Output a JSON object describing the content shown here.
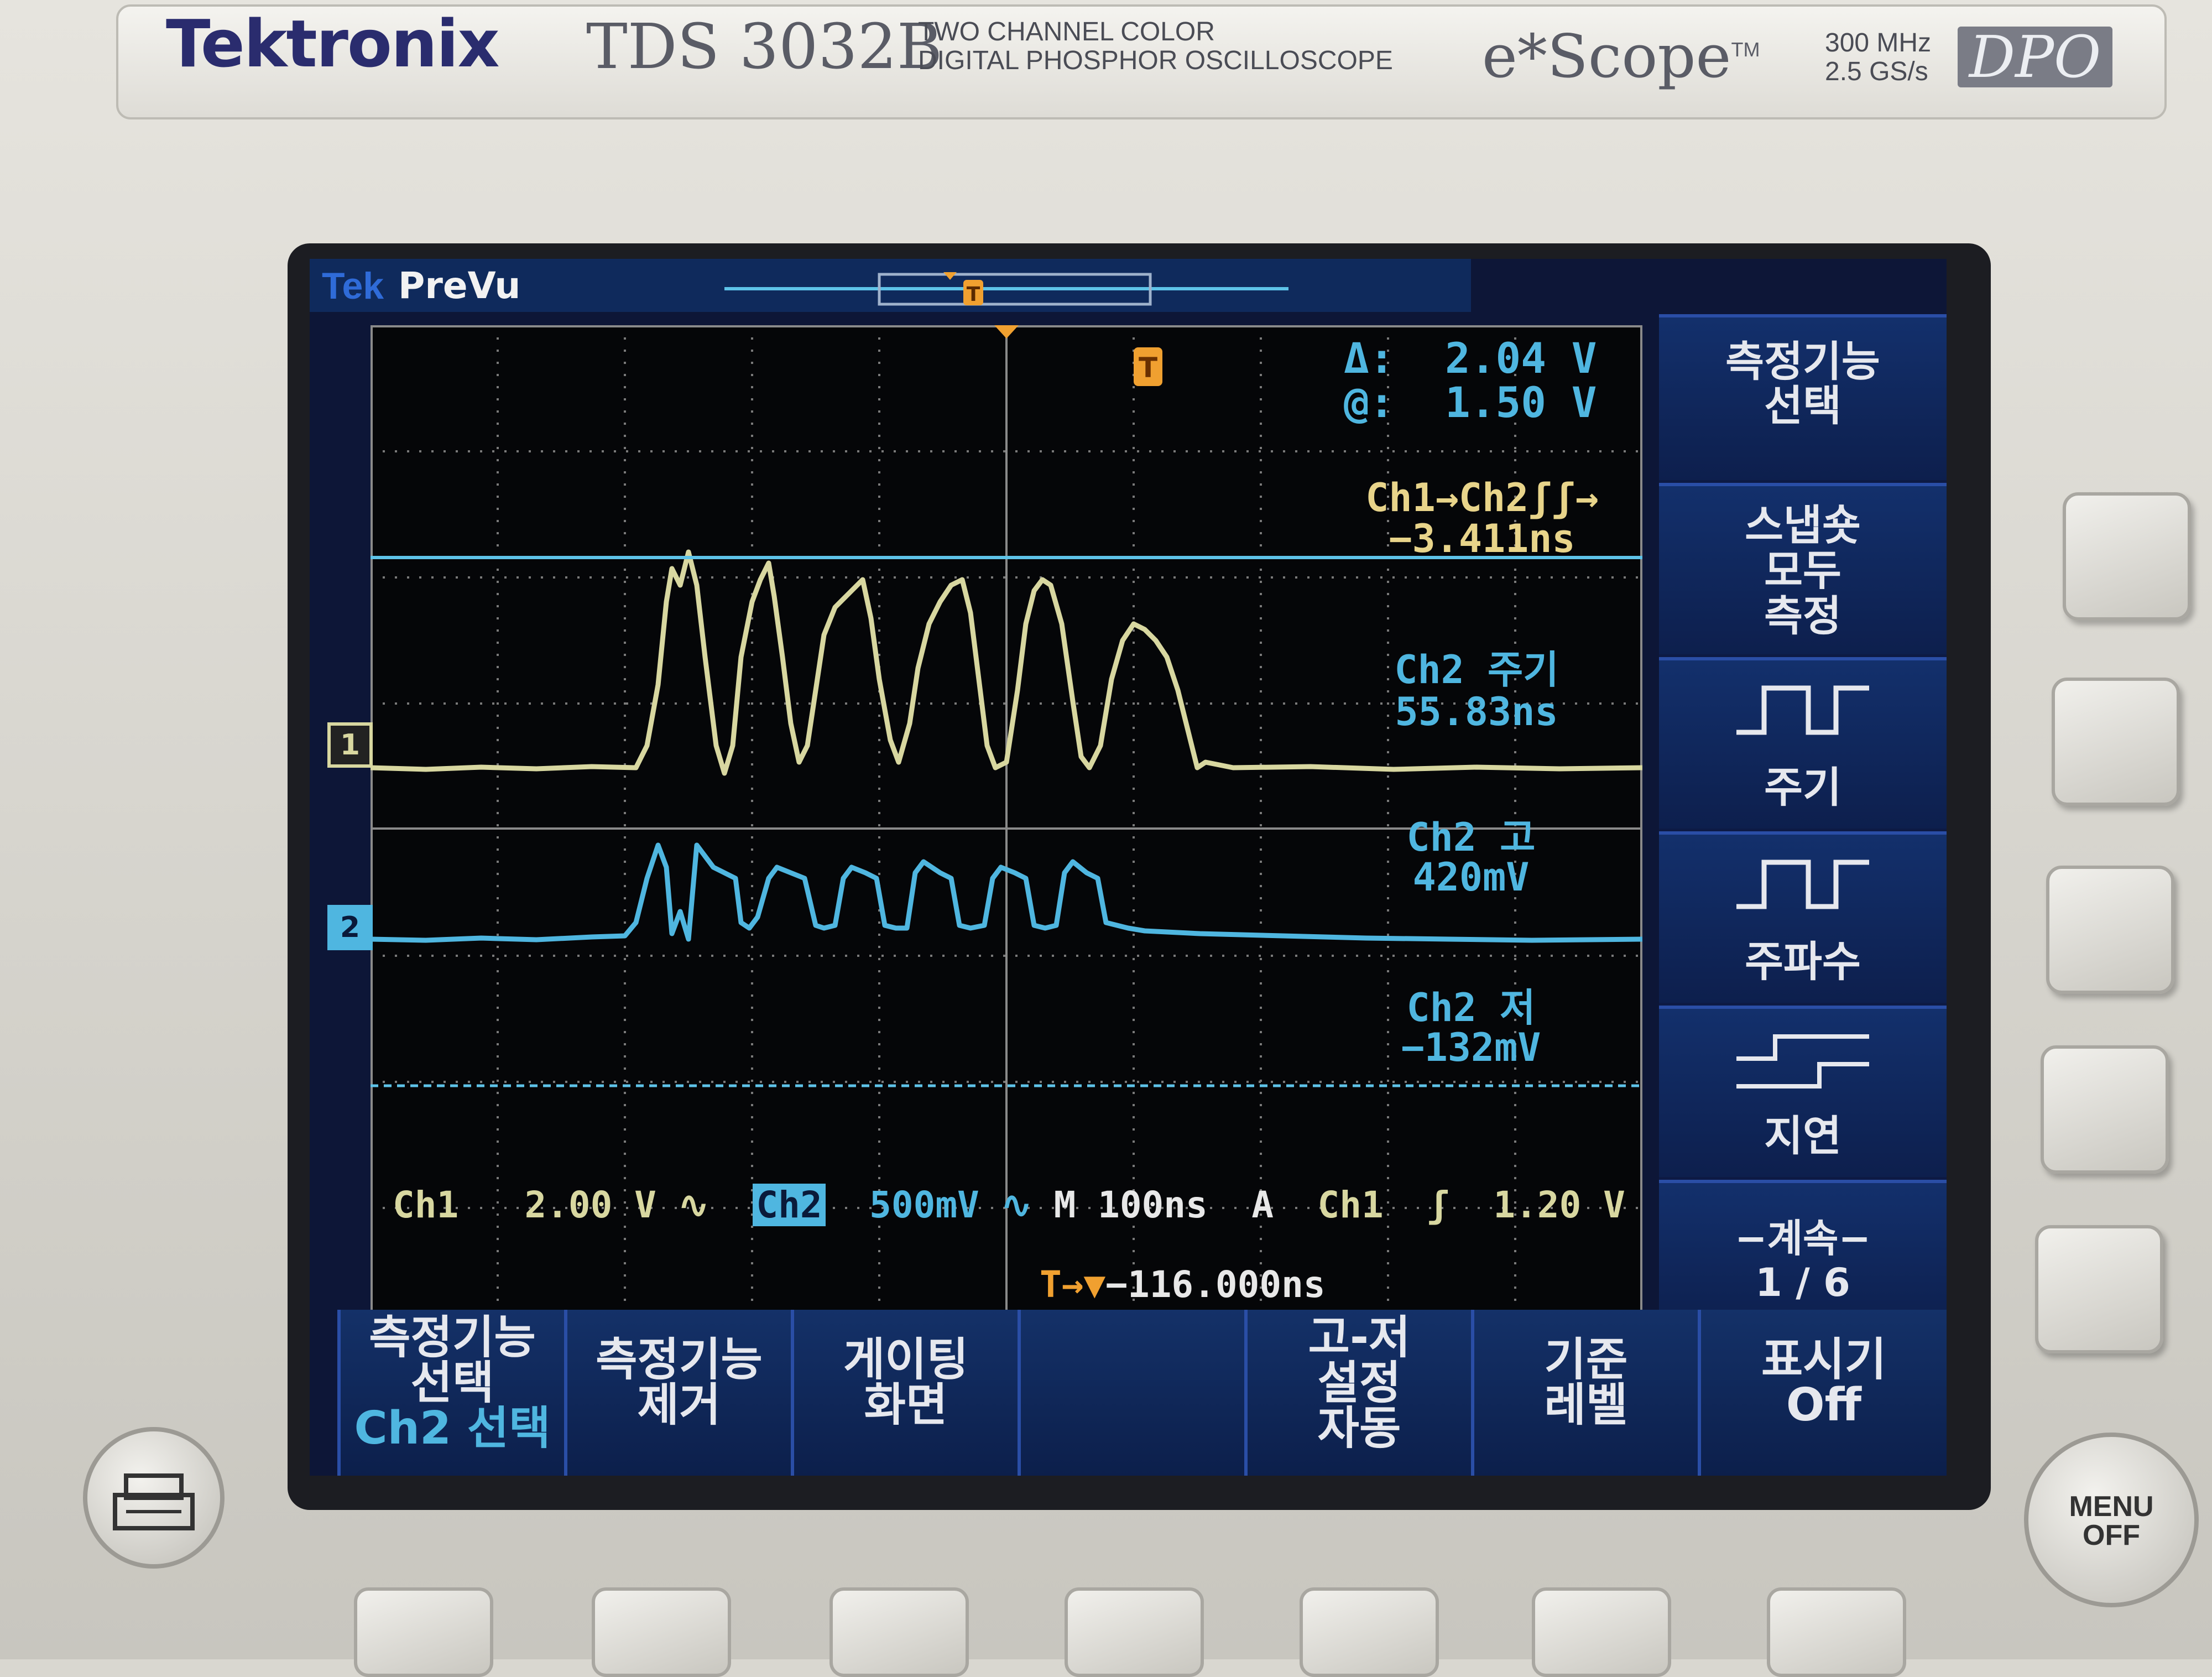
{
  "device": {
    "brand": "Tektronix",
    "model": "TDS 3032B",
    "description_line1": "TWO CHANNEL COLOR",
    "description_line2": "DIGITAL PHOSPHOR OSCILLOSCOPE",
    "series": "e*Scope",
    "series_tm": "TM",
    "bandwidth": "300 MHz",
    "sample_rate": "2.5 GS/s",
    "badge": "DPO"
  },
  "screen": {
    "logo": "Tek",
    "mode": "PreVu",
    "trigger_marker": "T",
    "readouts": {
      "delta_label": "Δ:",
      "delta_value": "2.04 V",
      "at_label": "@:",
      "at_value": "1.50 V",
      "delay_label": "Ch1→Ch2ʃʃ→",
      "delay_value": "−3.411ns",
      "period_label": "Ch2 주기",
      "period_value": "55.83ns",
      "high_label": "Ch2 고",
      "high_value": "420mV",
      "low_label": "Ch2 저",
      "low_value": "−132mV"
    },
    "channel_markers": {
      "ch1": "1",
      "ch2": "2"
    },
    "status": {
      "ch1_label": "Ch1",
      "ch1_scale": "2.00 V",
      "ch1_coupling": "∿",
      "ch2_label": "Ch2",
      "ch2_scale": "500mV",
      "ch2_coupling": "∿",
      "timebase": "M 100ns",
      "trigger_mode": "A",
      "trigger_source": "Ch1",
      "trigger_slope": "ʃ",
      "trigger_level": "1.20 V",
      "trigger_offset_prefix": "T→▼",
      "trigger_offset": "−116.000ns"
    },
    "side_menu": [
      {
        "label": "측정기능\n선택"
      },
      {
        "label": "스냅숏\n모두\n측정"
      },
      {
        "label": "주기",
        "icon": "period-waveform-icon"
      },
      {
        "label": "주파수",
        "icon": "frequency-waveform-icon"
      },
      {
        "label": "지연",
        "icon": "delay-waveform-icon"
      },
      {
        "label": "−계속−\n1 / 6"
      }
    ],
    "bottom_menu": [
      {
        "label": "측정기능\n선택",
        "sub": "Ch2 선택"
      },
      {
        "label": "측정기능\n제거"
      },
      {
        "label": "게이팅\n화면"
      },
      {
        "label": ""
      },
      {
        "label": "고-저\n설정\n자동"
      },
      {
        "label": "기준\n레벨"
      },
      {
        "label": "표시기\nOff"
      }
    ]
  },
  "hardware": {
    "menu_off_label1": "MENU",
    "menu_off_label2": "OFF",
    "print_icon": "printer-icon"
  },
  "colors": {
    "ch1": "#d8d7a0",
    "ch2": "#4fb6e0",
    "trigger": "#f0a030",
    "screen_bg": "#050608",
    "menu_bg": "#13306c"
  }
}
